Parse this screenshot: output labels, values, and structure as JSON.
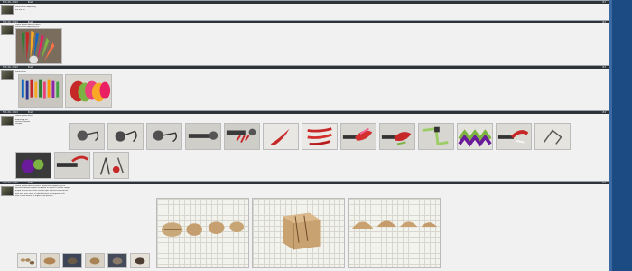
{
  "posts": [
    {
      "date": "Feb 26, 2010",
      "user": "Post",
      "lines": [
        "Lorem ipsum dolor sit amet,",
        "consectetur adipiscing",
        "elit sed do"
      ]
    },
    {
      "date": "Feb 26, 2010",
      "user": "Post",
      "lines": [
        "Lorem ipsum dolor sit amet",
        "consectetur adipiscing elit"
      ]
    },
    {
      "date": "Feb 26, 2010",
      "user": "Post",
      "lines": [
        "Lorem ipsum dolor sit amet",
        "consectetur"
      ]
    },
    {
      "date": "Feb 26, 2010",
      "user": "Post",
      "lines": [
        "Lorem ipsum dolor",
        "sit amet consectetur",
        "adipiscing elit",
        "sed do eiusmod",
        "tempor"
      ]
    },
    {
      "date": "Feb 26, 2010",
      "user": "Post",
      "lines": [
        "Lorem ipsum dolor sit amet, consectetur adipiscing elit",
        "sed do eiusmod tempor incididunt ut labore et dolore magna",
        "aliqua ut enim ad minim veniam quis nostrud exercitation",
        "ullamco laboris nisi ut aliquip ex ea commodo consequat",
        "duis aute irure dolor in reprehenderit in voluptate velit",
        "esse cillum dolore eu fugiat nulla pariatur"
      ]
    }
  ],
  "thumbnails": {
    "post2": [
      "feathers-fan"
    ],
    "post3": [
      "sticks-on-table",
      "colored-bundle"
    ],
    "post4_row1": [
      "jig-head-1",
      "jig-head-2",
      "jig-head-3",
      "jig-vise",
      "jig-red",
      "red-feather",
      "red-feathers",
      "red-fly",
      "red-green-fly",
      "green-fly",
      "purple-green-fly",
      "red-white-fly",
      "hook-tool"
    ],
    "post4_row2": [
      "purple-thread",
      "vise-red",
      "tools"
    ],
    "post5_small": [
      "eggs-small",
      "egg-small",
      "eggs-dark",
      "eggs-light",
      "eggs-pale",
      "egg-dark"
    ],
    "post5_large": [
      "wooden-eggs-row",
      "wooden-block",
      "wooden-domes"
    ]
  },
  "colors": {
    "bar": "#1c4a82",
    "header": "#2e3338"
  }
}
